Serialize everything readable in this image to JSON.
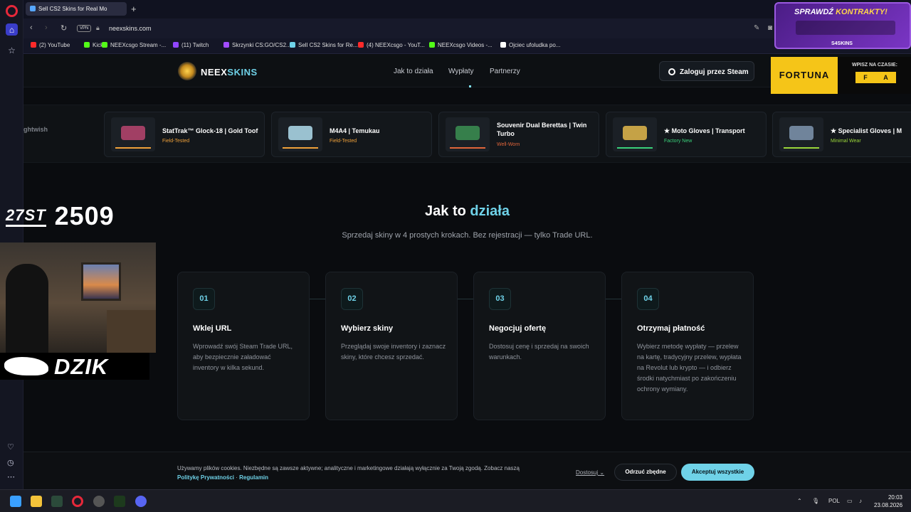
{
  "browser": {
    "tab_title": "Sell CS2 Skins for Real Mo",
    "new_tab": "+",
    "vpn_badge": "VPN",
    "url": "neexskins.com",
    "bookmarks": [
      {
        "label": "(2) YouTube",
        "color": "#ff2a2a"
      },
      {
        "label": "Kick",
        "color": "#53fc18"
      },
      {
        "label": "NEEXcsgo Stream -...",
        "color": "#53fc18"
      },
      {
        "label": "(11) Twitch",
        "color": "#9146ff"
      },
      {
        "label": "Skrzynki CS:GO/CS2...",
        "color": "#a24cff"
      },
      {
        "label": "Sell CS2 Skins for Re...",
        "color": "#6fd2e8"
      },
      {
        "label": "(4) NEEXcsgo - YouT...",
        "color": "#ff2a2a"
      },
      {
        "label": "NEEXcsgo Videos -...",
        "color": "#53fc18"
      },
      {
        "label": "Ojciec ufoludka po...",
        "color": "#ffffff"
      }
    ]
  },
  "site": {
    "brand_a": "NEEX",
    "brand_b": "SKINS",
    "nav": [
      "Jak to działa",
      "Wypłaty",
      "Partnerzy"
    ],
    "login": "Zaloguj przez Steam",
    "faded_item": "ghtwish",
    "skins": [
      {
        "name": "StatTrak™ Glock-18 | Gold Toof",
        "wear": "Field-Tested",
        "wear_color": "#f0a13a",
        "item_color": "#b0436b"
      },
      {
        "name": "M4A4 | Temukau",
        "wear": "Field-Tested",
        "wear_color": "#f0a13a",
        "item_color": "#a8d3e3"
      },
      {
        "name": "Souvenir Dual Berettas | Twin Turbo",
        "wear": "Well-Worn",
        "wear_color": "#e0653a",
        "item_color": "#3a8a50"
      },
      {
        "name": "★ Moto Gloves | Transport",
        "wear": "Factory New",
        "wear_color": "#3ad07a",
        "item_color": "#d8b04a"
      },
      {
        "name": "★ Specialist Gloves | M",
        "wear": "Minimal Wear",
        "wear_color": "#9ad63a",
        "item_color": "#7a8fa8"
      }
    ],
    "section_title_a": "Jak to ",
    "section_title_b": "działa",
    "section_sub": "Sprzedaj skiny w 4 prostych krokach. Bez rejestracji — tylko Trade URL.",
    "steps": [
      {
        "num": "01",
        "title": "Wklej URL",
        "desc": "Wprowadź swój Steam Trade URL, aby bezpiecznie załadować inventory w kilka sekund."
      },
      {
        "num": "02",
        "title": "Wybierz skiny",
        "desc": "Przeglądaj swoje inventory i zaznacz skiny, które chcesz sprzedać."
      },
      {
        "num": "03",
        "title": "Negocjuj ofertę",
        "desc": "Dostosuj cenę i sprzedaj na swoich warunkach."
      },
      {
        "num": "04",
        "title": "Otrzymaj płatność",
        "desc": "Wybierz metodę wypłaty — przelew na kartę, tradycyjny przelew, wypłata na Revolut lub krypto — i odbierz środki natychmiast po zakończeniu ochrony wymiany."
      }
    ],
    "cookie": {
      "text": "Używamy plików cookies. Niezbędne są zawsze aktywne; analityczne i marketingowe działają wyłącznie za Twoją zgodą. Zobacz naszą",
      "privacy": "Politykę Prywatności",
      "sep": " · ",
      "terms": "Regulamin",
      "customize": "Dostosuj",
      "reject": "Odrzuć zbędne",
      "accept": "Akceptuj wszystkie"
    }
  },
  "overlay": {
    "fortuna": "FORTUNA",
    "fortuna_sub": "WPISZ NA CZASIE:",
    "code": [
      "F",
      "A"
    ],
    "promo_a": "SPRAWDŹ ",
    "promo_b": "KONTRAKTY!",
    "promo_brand": "S4SKINS",
    "subs_badge": "27ST",
    "subs_count": "2509",
    "sponsor": "DZIK"
  },
  "taskbar": {
    "lang": "POL",
    "time": "20:03",
    "date": "23.08.2026"
  }
}
